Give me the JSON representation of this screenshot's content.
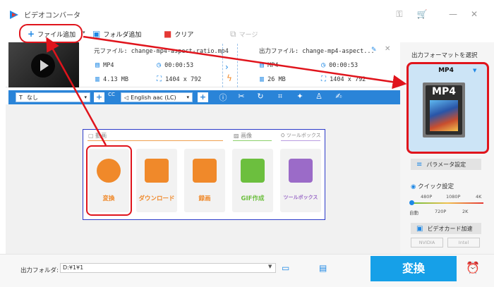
{
  "app": {
    "title": "ビデオコンバータ"
  },
  "toolbar": {
    "add_file": "ファイル追加",
    "add_folder": "フォルダ追加",
    "clear": "クリア",
    "merge": "マージ"
  },
  "file": {
    "source_label": "元ファイル:",
    "source_name": "change-mp4-aspect-ratio.mp4",
    "output_label": "出力ファイル:",
    "output_name": "change-mp4-aspect...",
    "src_format": "MP4",
    "src_duration": "00:00:53",
    "src_size": "4.13 MB",
    "src_resolution": "1404 x 792",
    "out_format": "MP4",
    "out_duration": "00:00:53",
    "out_size": "26 MB",
    "out_resolution": "1404 x 792"
  },
  "bluebar": {
    "subtitle": "なし",
    "audio": "English aac (LC)",
    "cc": "CC"
  },
  "toolbox": {
    "cat_video": "動画",
    "cat_image": "画像",
    "cat_tools": "ツールボックス",
    "cards": [
      {
        "label": "変換",
        "color": "#f0892a"
      },
      {
        "label": "ダウンロード",
        "color": "#f0892a"
      },
      {
        "label": "録画",
        "color": "#f0892a"
      },
      {
        "label": "GIF作成",
        "color": "#6cbf3e"
      },
      {
        "label": "ツールボックス",
        "color": "#9b6bc8"
      }
    ]
  },
  "right": {
    "title": "出力フォーマットを選択",
    "format": "MP4",
    "format_icon_text": "MP4",
    "param_btn": "パラメータ設定",
    "quick_label": "クイック設定",
    "quick_ticks_top": [
      "480P",
      "1080P",
      "4K"
    ],
    "quick_ticks_bottom": [
      "自動",
      "720P",
      "2K"
    ],
    "gpu_btn": "ビデオカード加速",
    "nvidia": "NVIDIA",
    "intel": "Intel"
  },
  "bottom": {
    "out_folder_label": "出力フォルダ:",
    "out_folder_value": "D:¥1¥1",
    "convert": "変換"
  },
  "colors": {
    "accent": "#2a84d8",
    "convert": "#16a0e8",
    "annotation": "#e0141c"
  }
}
